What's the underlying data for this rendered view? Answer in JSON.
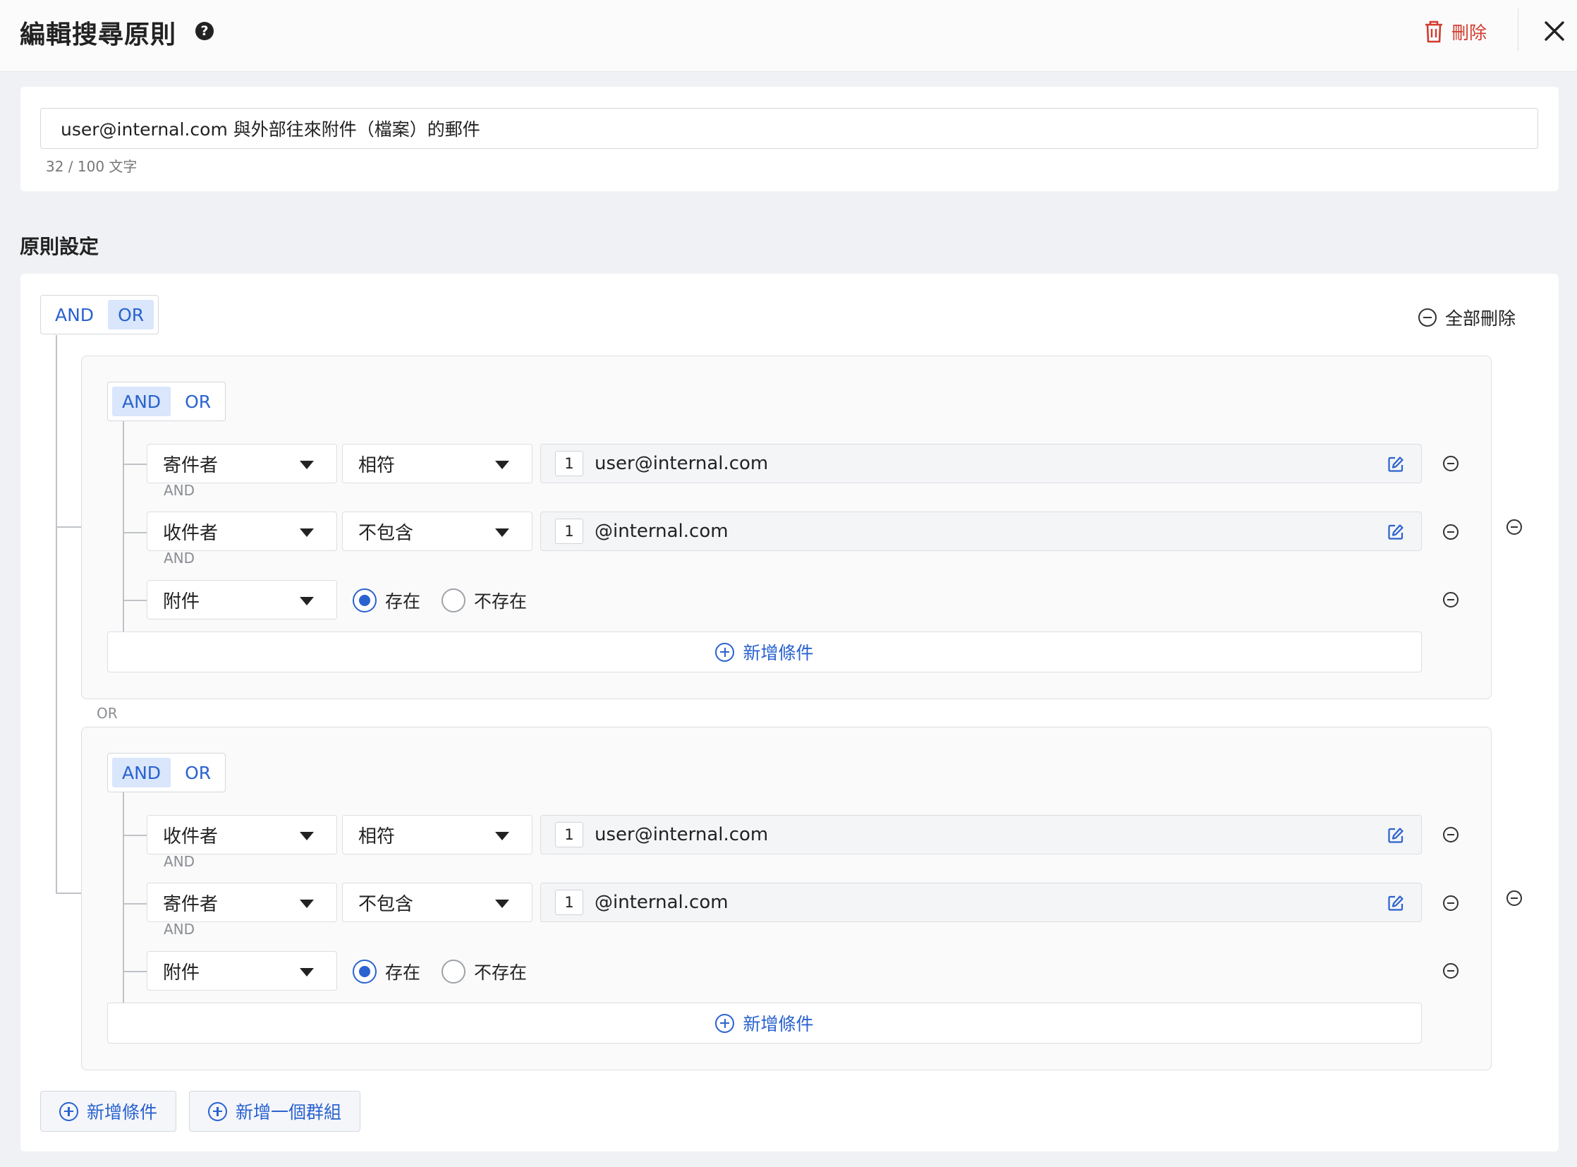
{
  "header": {
    "title": "編輯搜尋原則",
    "help_glyph": "?",
    "delete_label": "刪除"
  },
  "rule_name": {
    "value": "user@internal.com 與外部往來附件（檔案）的郵件",
    "char_count": "32 / 100 文字"
  },
  "section_title": "原則設定",
  "root": {
    "toggle": {
      "and": "AND",
      "or": "OR",
      "active": "OR"
    },
    "clear_all_label": "全部刪除",
    "or_connector": "OR",
    "groups": [
      {
        "toggle": {
          "and": "AND",
          "or": "OR",
          "active": "AND"
        },
        "connector": "AND",
        "conditions": [
          {
            "field": "寄件者",
            "operator": "相符",
            "count": "1",
            "value": "user@internal.com"
          },
          {
            "field": "收件者",
            "operator": "不包含",
            "count": "1",
            "value": "@internal.com"
          },
          {
            "field": "附件",
            "radio_exists": "存在",
            "radio_not_exists": "不存在",
            "selected": "存在"
          }
        ],
        "add_condition_label": "新增條件"
      },
      {
        "toggle": {
          "and": "AND",
          "or": "OR",
          "active": "AND"
        },
        "connector": "AND",
        "conditions": [
          {
            "field": "收件者",
            "operator": "相符",
            "count": "1",
            "value": "user@internal.com"
          },
          {
            "field": "寄件者",
            "operator": "不包含",
            "count": "1",
            "value": "@internal.com"
          },
          {
            "field": "附件",
            "radio_exists": "存在",
            "radio_not_exists": "不存在",
            "selected": "存在"
          }
        ],
        "add_condition_label": "新增條件"
      }
    ],
    "add_condition_label": "新增條件",
    "add_group_label": "新增一個群組"
  },
  "colors": {
    "accent": "#2a62d0",
    "danger": "#d33a2c",
    "toggle_active_bg": "#d9e6fb",
    "page_bg": "#f0f1f4"
  }
}
